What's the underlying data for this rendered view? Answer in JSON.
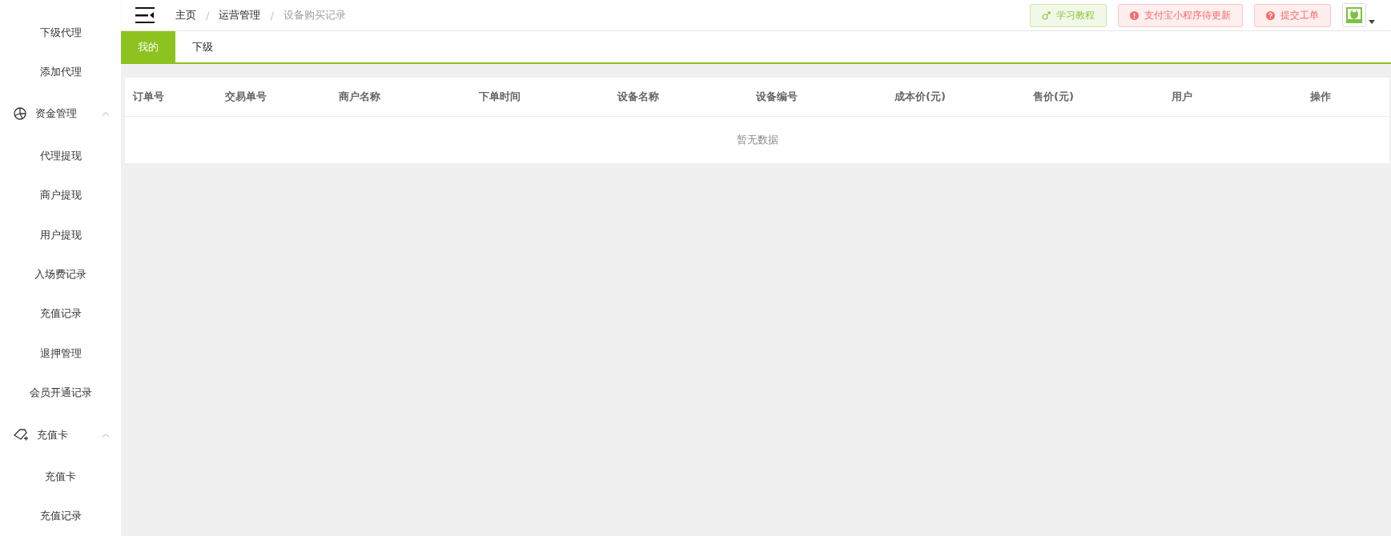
{
  "sidebar": {
    "items": [
      {
        "kind": "link",
        "label": "下级代理"
      },
      {
        "kind": "link",
        "label": "添加代理"
      },
      {
        "kind": "chart-group",
        "label": "资金管理",
        "expanded": true,
        "children": [
          {
            "label": "代理提现"
          },
          {
            "label": "商户提现"
          },
          {
            "label": "用户提现"
          },
          {
            "label": "入场费记录"
          },
          {
            "label": "充值记录"
          },
          {
            "label": "退押管理"
          },
          {
            "label": "会员开通记录"
          }
        ]
      },
      {
        "kind": "card-group",
        "label": "充值卡",
        "expanded": true,
        "children": [
          {
            "label": "充值卡"
          },
          {
            "label": "充值记录"
          }
        ]
      }
    ]
  },
  "breadcrumb": [
    {
      "label": "主页",
      "current": false
    },
    {
      "separator": "/",
      "label": "运营管理",
      "current": false
    },
    {
      "separator": "/",
      "label": "设备购买记录",
      "current": true
    }
  ],
  "header_buttons": [
    {
      "kind": "tutorial",
      "label": "学习教程"
    },
    {
      "kind": "warning",
      "label": "支付宝小程序待更新"
    },
    {
      "kind": "help",
      "label": "提交工单"
    }
  ],
  "tabs": [
    {
      "label": "我的",
      "selected": true
    },
    {
      "label": "下级",
      "selected": false
    }
  ],
  "table": {
    "columns": [
      "订单号",
      "交易单号",
      "商户名称",
      "下单时间",
      "设备名称",
      "设备编号",
      "成本价(元)",
      "售价(元)",
      "用户",
      "操作"
    ],
    "empty_text": "暂无数据"
  }
}
